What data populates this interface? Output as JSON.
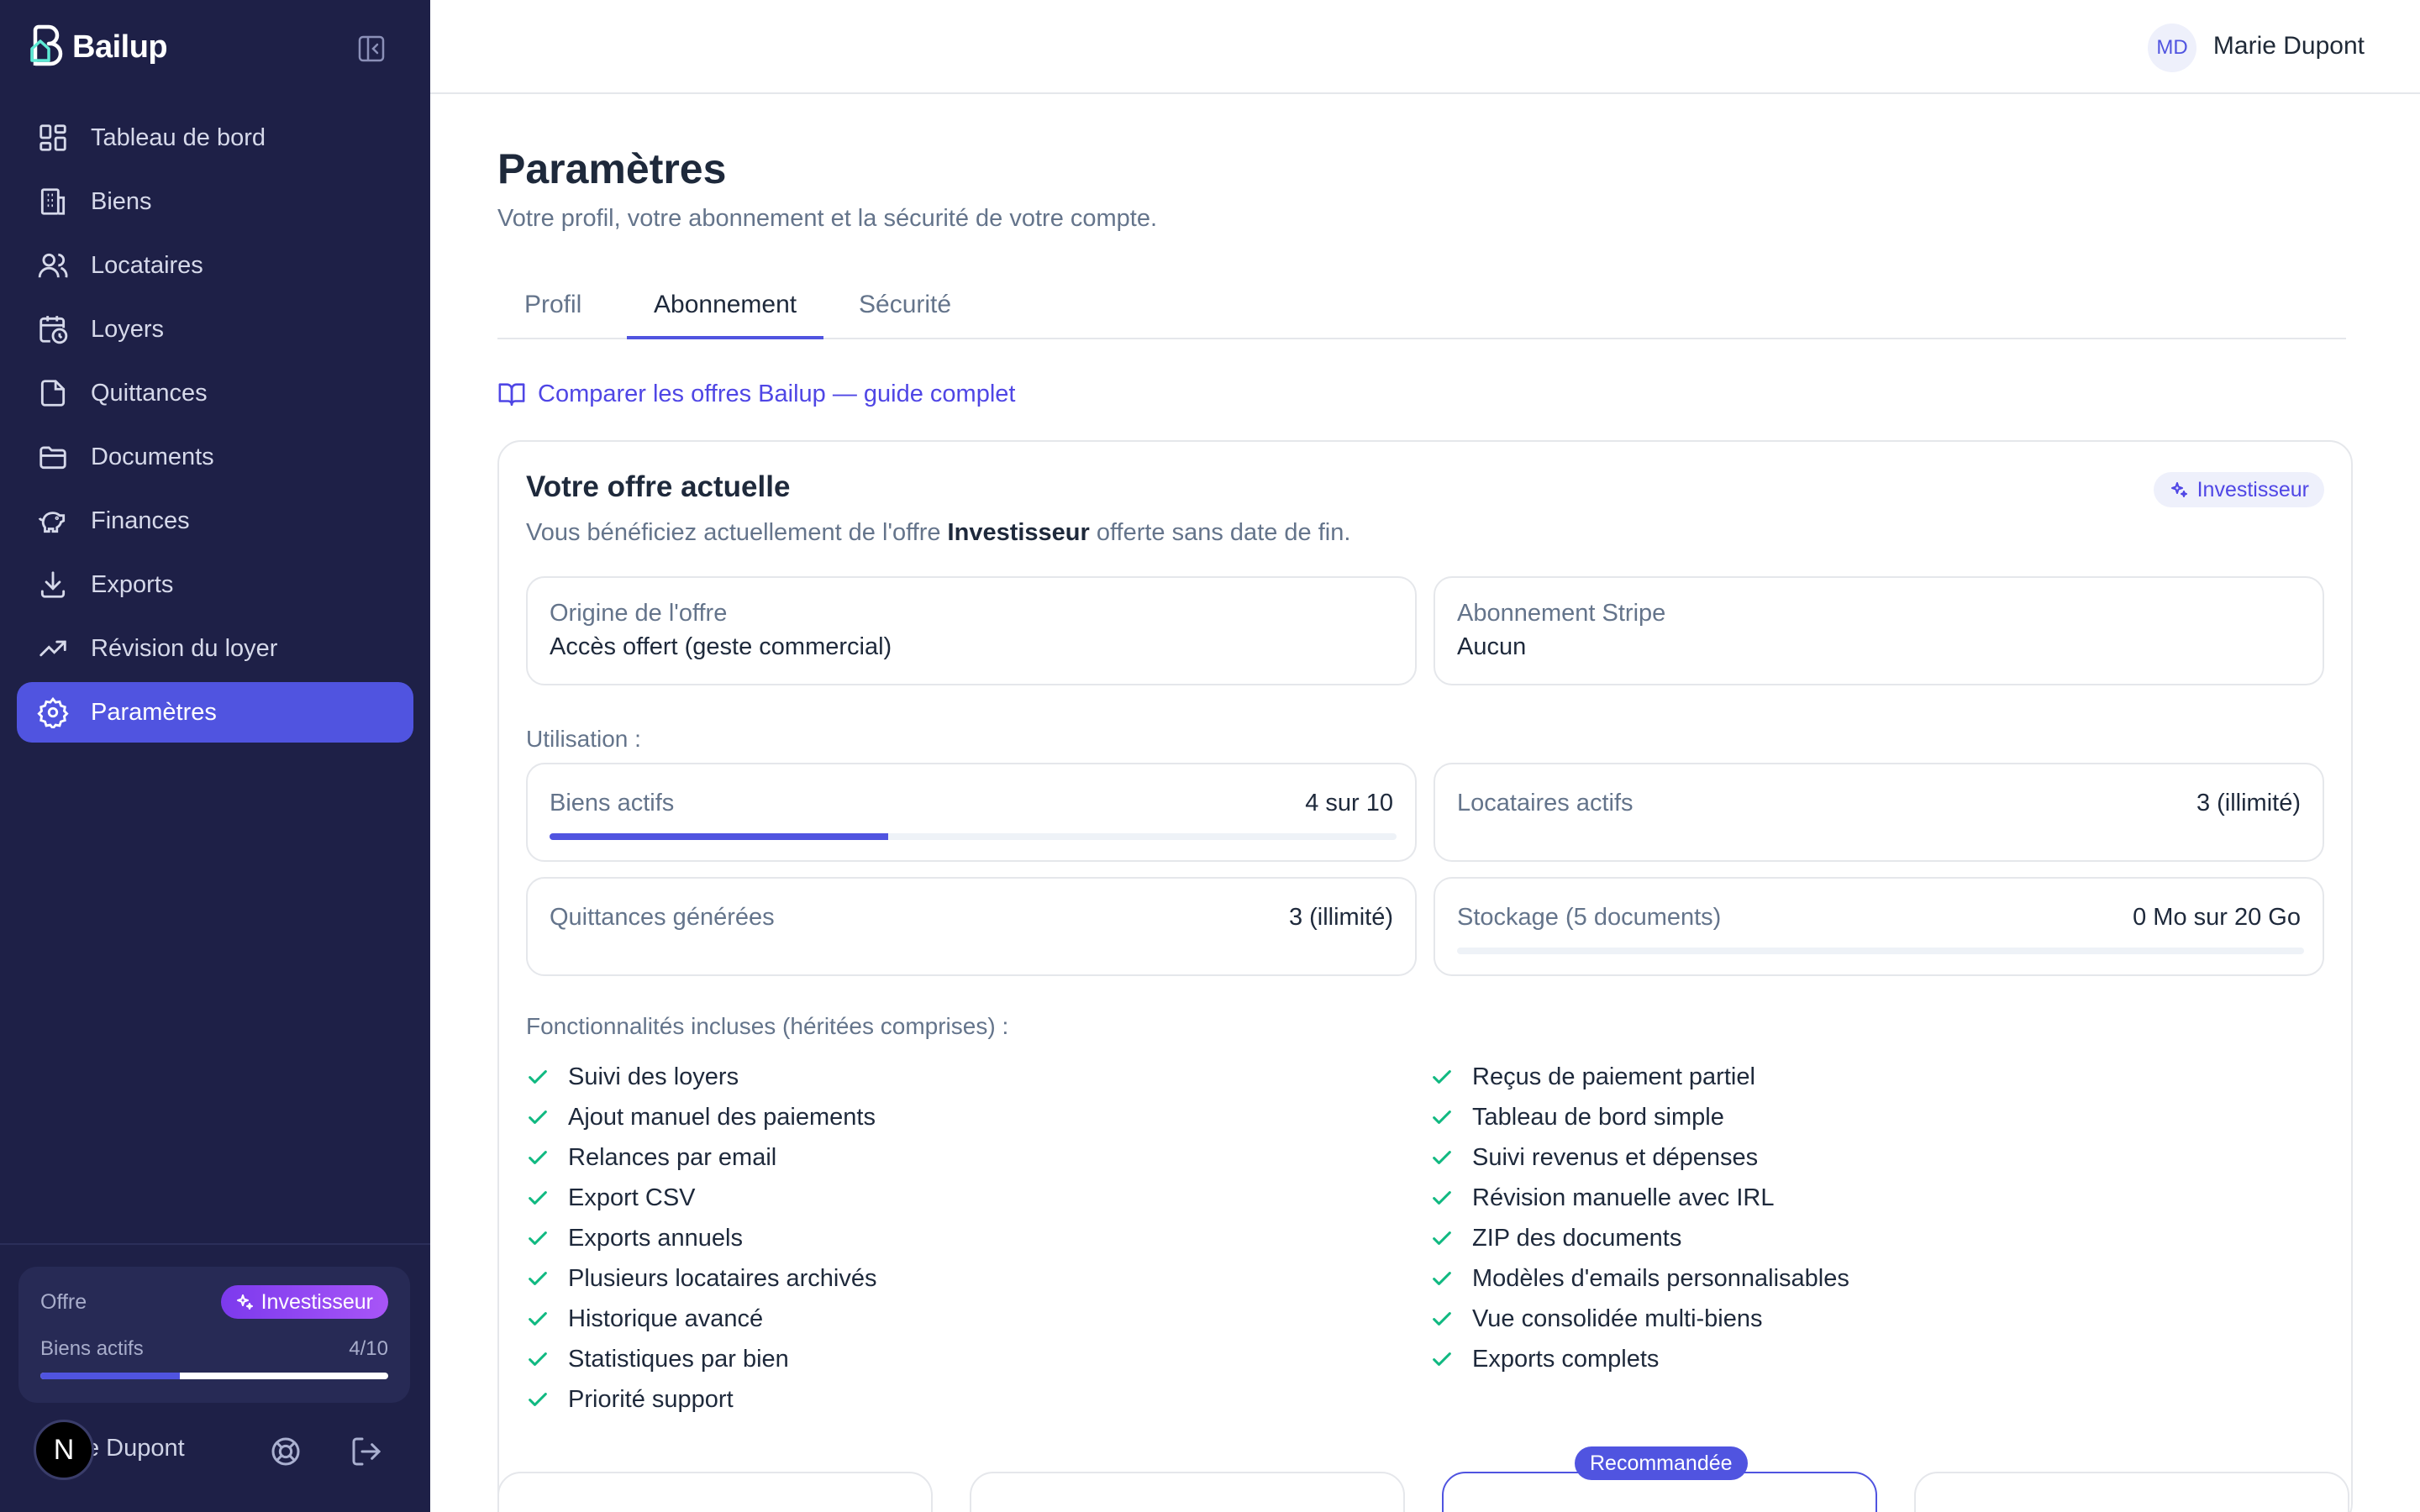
{
  "brand": {
    "name": "Bailup"
  },
  "sidebar": {
    "items": [
      {
        "label": "Tableau de bord",
        "icon": "dashboard-icon",
        "active": false
      },
      {
        "label": "Biens",
        "icon": "building-icon",
        "active": false
      },
      {
        "label": "Locataires",
        "icon": "users-icon",
        "active": false
      },
      {
        "label": "Loyers",
        "icon": "calendar-clock-icon",
        "active": false
      },
      {
        "label": "Quittances",
        "icon": "file-icon",
        "active": false
      },
      {
        "label": "Documents",
        "icon": "folder-icon",
        "active": false
      },
      {
        "label": "Finances",
        "icon": "piggy-bank-icon",
        "active": false
      },
      {
        "label": "Exports",
        "icon": "download-icon",
        "active": false
      },
      {
        "label": "Révision du loyer",
        "icon": "trending-up-icon",
        "active": false
      },
      {
        "label": "Paramètres",
        "icon": "gear-icon",
        "active": true
      }
    ],
    "plan": {
      "label": "Offre",
      "badge": "Investisseur",
      "usage_label": "Biens actifs",
      "usage_value": "4/10",
      "usage_fraction": 0.4
    },
    "user": {
      "avatar": "N",
      "name_visible": "e Dupont"
    }
  },
  "topbar": {
    "avatar_initials": "MD",
    "user_name": "Marie Dupont"
  },
  "page": {
    "title": "Paramètres",
    "subtitle": "Votre profil, votre abonnement et la sécurité de votre compte."
  },
  "tabs": [
    {
      "label": "Profil",
      "active": false
    },
    {
      "label": "Abonnement",
      "active": true
    },
    {
      "label": "Sécurité",
      "active": false
    }
  ],
  "guide_link": "Comparer les offres Bailup — guide complet",
  "current_plan": {
    "title": "Votre offre actuelle",
    "badge": "Investisseur",
    "desc_prefix": "Vous bénéficiez actuellement de l'offre ",
    "desc_plan": "Investisseur",
    "desc_suffix": " offerte sans date de fin.",
    "origin_label": "Origine de l'offre",
    "origin_value": "Accès offert (geste commercial)",
    "stripe_label": "Abonnement Stripe",
    "stripe_value": "Aucun",
    "usage_title": "Utilisation :",
    "usage": [
      {
        "label": "Biens actifs",
        "value": "4 sur 10",
        "fraction": 0.4,
        "bar": true
      },
      {
        "label": "Locataires actifs",
        "value": "3 (illimité)",
        "bar": false
      },
      {
        "label": "Quittances générées",
        "value": "3 (illimité)",
        "bar": false
      },
      {
        "label": "Stockage (5 documents)",
        "value": "0 Mo sur 20 Go",
        "fraction": 0.0,
        "bar": true
      }
    ],
    "features_title": "Fonctionnalités incluses (héritées comprises) :",
    "features_left": [
      "Suivi des loyers",
      "Ajout manuel des paiements",
      "Relances par email",
      "Export CSV",
      "Exports annuels",
      "Plusieurs locataires archivés",
      "Historique avancé",
      "Statistiques par bien",
      "Priorité support"
    ],
    "features_right": [
      "Reçus de paiement partiel",
      "Tableau de bord simple",
      "Suivi revenus et dépenses",
      "Révision manuelle avec IRL",
      "ZIP des documents",
      "Modèles d'emails personnalisables",
      "Vue consolidée multi-biens",
      "Exports complets"
    ]
  },
  "plans_row": {
    "recommended_badge": "Recommandée"
  },
  "colors": {
    "accent": "#5054e0",
    "sidebar_bg": "#1e2047",
    "check": "#10b981"
  }
}
